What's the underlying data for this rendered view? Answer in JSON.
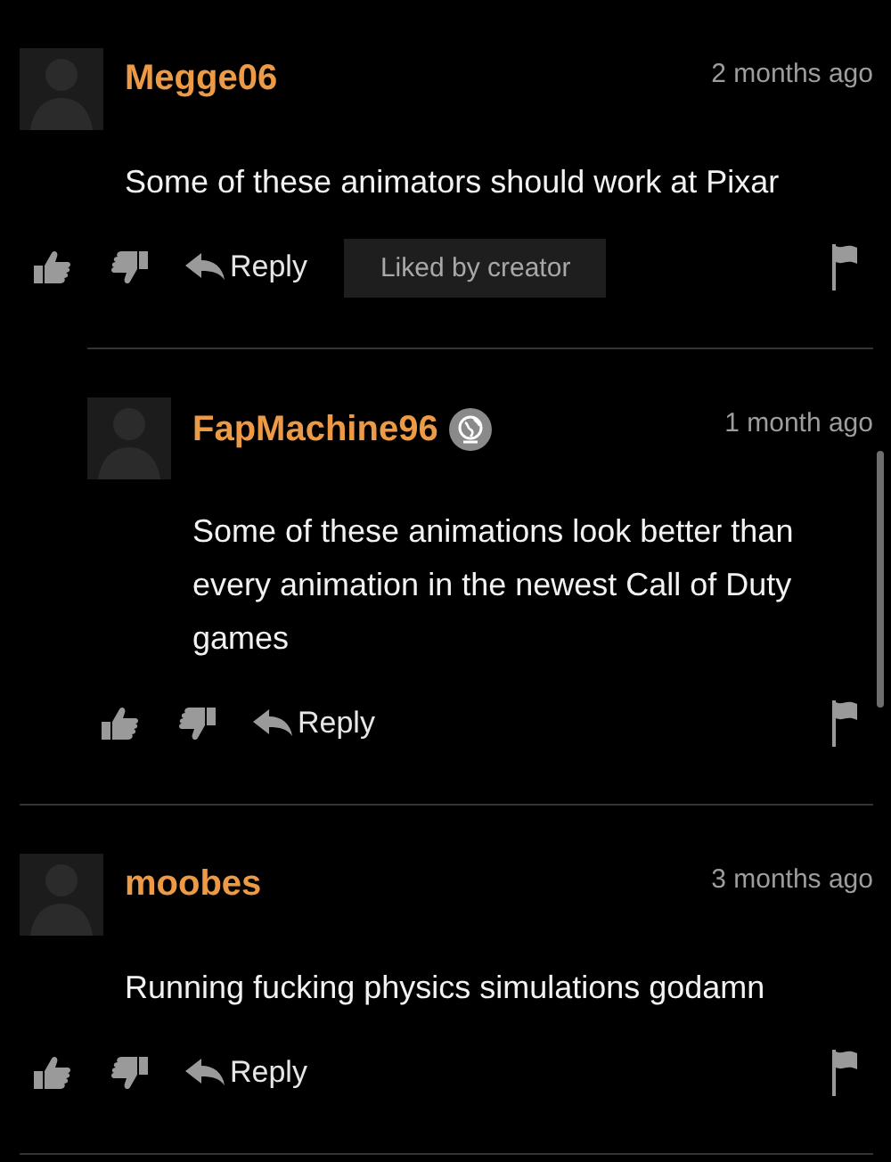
{
  "comments": [
    {
      "username": "Megge06",
      "badge_icon": false,
      "time": "2 months ago",
      "text": "Some of these animators should work at Pixar",
      "reply_label": "Reply",
      "creator_badge": "Liked by creator",
      "replies": [
        {
          "username": "FapMachine96",
          "badge_icon": true,
          "time": "1 month ago",
          "text": "Some of these animations look better than every animation in the newest Call of Duty games",
          "reply_label": "Reply"
        }
      ]
    },
    {
      "username": "moobes",
      "badge_icon": false,
      "time": "3 months ago",
      "text": "Running fucking physics simulations godamn",
      "reply_label": "Reply"
    }
  ]
}
